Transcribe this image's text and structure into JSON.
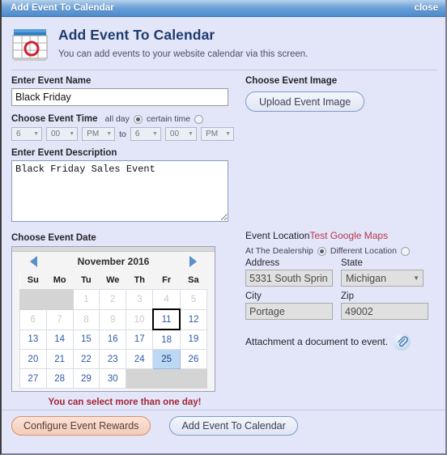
{
  "titlebar": {
    "title": "Add Event To Calendar",
    "close_label": "close"
  },
  "header": {
    "icon": "calendar-icon",
    "title": "Add Event To Calendar",
    "subtitle": "You can add events to your website calendar via this screen."
  },
  "event_name": {
    "label": "Enter Event Name",
    "value": "Black Friday",
    "placeholder": ""
  },
  "event_time": {
    "label": "Choose Event Time",
    "options": [
      {
        "label": "all day",
        "selected": true
      },
      {
        "label": "certain time",
        "selected": false
      }
    ],
    "separator": "to",
    "start": {
      "hour": "6",
      "minute": "00",
      "meridiem": "PM"
    },
    "end": {
      "hour": "6",
      "minute": "00",
      "meridiem": "PM"
    },
    "arrow": "▼"
  },
  "event_description": {
    "label": "Enter Event Description",
    "value": "Black Friday Sales Event",
    "placeholder": ""
  },
  "event_date": {
    "label": "Choose Event Date",
    "month_title": "November 2016",
    "prev_label": "previous-month",
    "next_label": "next-month",
    "weekdays": [
      "Su",
      "Mo",
      "Tu",
      "We",
      "Th",
      "Fr",
      "Sa"
    ],
    "weeks": [
      [
        {
          "day": "",
          "state": "empty"
        },
        {
          "day": "",
          "state": "empty"
        },
        {
          "day": "1",
          "state": "dim"
        },
        {
          "day": "2",
          "state": "dim"
        },
        {
          "day": "3",
          "state": "dim"
        },
        {
          "day": "4",
          "state": "dim"
        },
        {
          "day": "5",
          "state": "dim"
        }
      ],
      [
        {
          "day": "6",
          "state": "dim"
        },
        {
          "day": "7",
          "state": "dim"
        },
        {
          "day": "8",
          "state": "dim"
        },
        {
          "day": "9",
          "state": "dim"
        },
        {
          "day": "10",
          "state": "dim"
        },
        {
          "day": "11",
          "state": "today"
        },
        {
          "day": "12",
          "state": "normal"
        }
      ],
      [
        {
          "day": "13",
          "state": "normal"
        },
        {
          "day": "14",
          "state": "normal"
        },
        {
          "day": "15",
          "state": "normal"
        },
        {
          "day": "16",
          "state": "normal"
        },
        {
          "day": "17",
          "state": "normal"
        },
        {
          "day": "18",
          "state": "normal"
        },
        {
          "day": "19",
          "state": "normal"
        }
      ],
      [
        {
          "day": "20",
          "state": "normal"
        },
        {
          "day": "21",
          "state": "normal"
        },
        {
          "day": "22",
          "state": "normal"
        },
        {
          "day": "23",
          "state": "normal"
        },
        {
          "day": "24",
          "state": "normal"
        },
        {
          "day": "25",
          "state": "picked"
        },
        {
          "day": "26",
          "state": "normal"
        }
      ],
      [
        {
          "day": "27",
          "state": "normal"
        },
        {
          "day": "28",
          "state": "normal"
        },
        {
          "day": "29",
          "state": "normal"
        },
        {
          "day": "30",
          "state": "normal"
        },
        {
          "day": "",
          "state": "empty"
        },
        {
          "day": "",
          "state": "empty"
        },
        {
          "day": "",
          "state": "empty"
        }
      ]
    ],
    "note": "You can select more than one day!"
  },
  "event_image": {
    "label": "Choose Event Image",
    "upload_label": "Upload Event Image"
  },
  "event_location": {
    "label": "Event Location",
    "test_link": "Test Google Maps",
    "options": [
      {
        "label": "At The Dealership",
        "selected": true
      },
      {
        "label": "Different Location",
        "selected": false
      }
    ],
    "address": {
      "label": "Address",
      "value": "5331 South Sprin"
    },
    "state": {
      "label": "State",
      "value": "Michigan",
      "arrow": "▼"
    },
    "city": {
      "label": "City",
      "value": "Portage"
    },
    "zip": {
      "label": "Zip",
      "value": "49002"
    }
  },
  "attachment": {
    "label": "Attachment a document to event.",
    "icon": "paperclip-icon"
  },
  "footer": {
    "configure_label": "Configure Event Rewards",
    "submit_label": "Add Event To Calendar"
  },
  "colors": {
    "titlebar_blue": "#6aa0d8",
    "body_bg": "#e3e5f9",
    "accent_red": "#a32638",
    "link_red": "#b5394f",
    "day_blue": "#2d59a8",
    "selected_day": "#bcd8f5",
    "orange_button": "#f3cdbb"
  }
}
